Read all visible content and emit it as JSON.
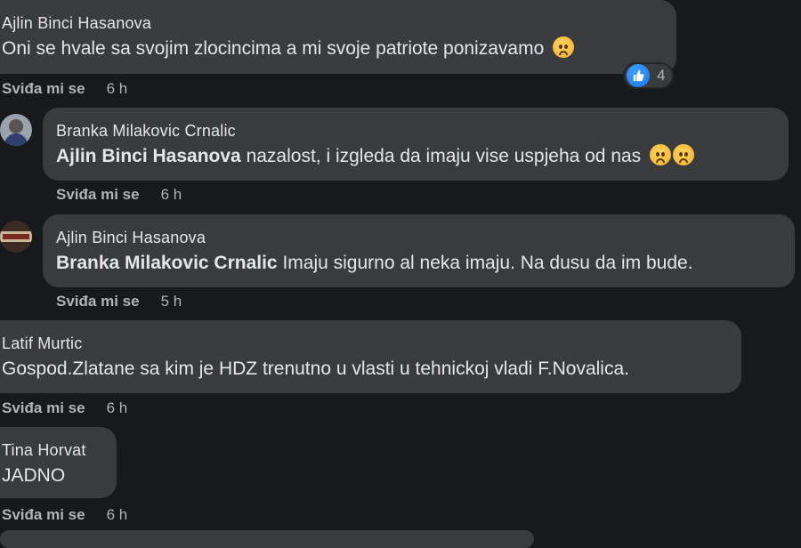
{
  "comments": [
    {
      "author": "Ajlin Binci Hasanova",
      "text": "Oni se hvale sa svojim zlocincima a mi svoje patriote ponizavamo",
      "emoji": "sad-face",
      "reaction_count": "4",
      "like_label": "Sviđa mi se",
      "time": "6 h"
    },
    {
      "author": "Branka Milakovic Crnalic",
      "mention": "Ajlin Binci Hasanova",
      "text": "nazalost, i izgleda da imaju vise uspjeha od nas",
      "emoji": "sad-face",
      "like_label": "Sviđa mi se",
      "time": "6 h"
    },
    {
      "author": "Ajlin Binci Hasanova",
      "mention": "Branka Milakovic Crnalic",
      "text": "Imaju sigurno al neka imaju. Na dusu da im bude.",
      "like_label": "Sviđa mi se",
      "time": "5 h"
    },
    {
      "author": "Latif Murtic",
      "text": "Gospod.Zlatane sa kim je HDZ trenutno u vlasti u tehnickoj vladi F.Novalica.",
      "like_label": "Sviđa mi se",
      "time": "6 h"
    },
    {
      "author": "Tina Horvat",
      "text": "JADNO",
      "like_label": "Sviđa mi se",
      "time": "6 h"
    }
  ],
  "colors": {
    "background": "#18191a",
    "bubble": "#3a3b3c",
    "text": "#e4e6eb",
    "secondary": "#b0b3b8",
    "like_blue": "#1877f2"
  }
}
